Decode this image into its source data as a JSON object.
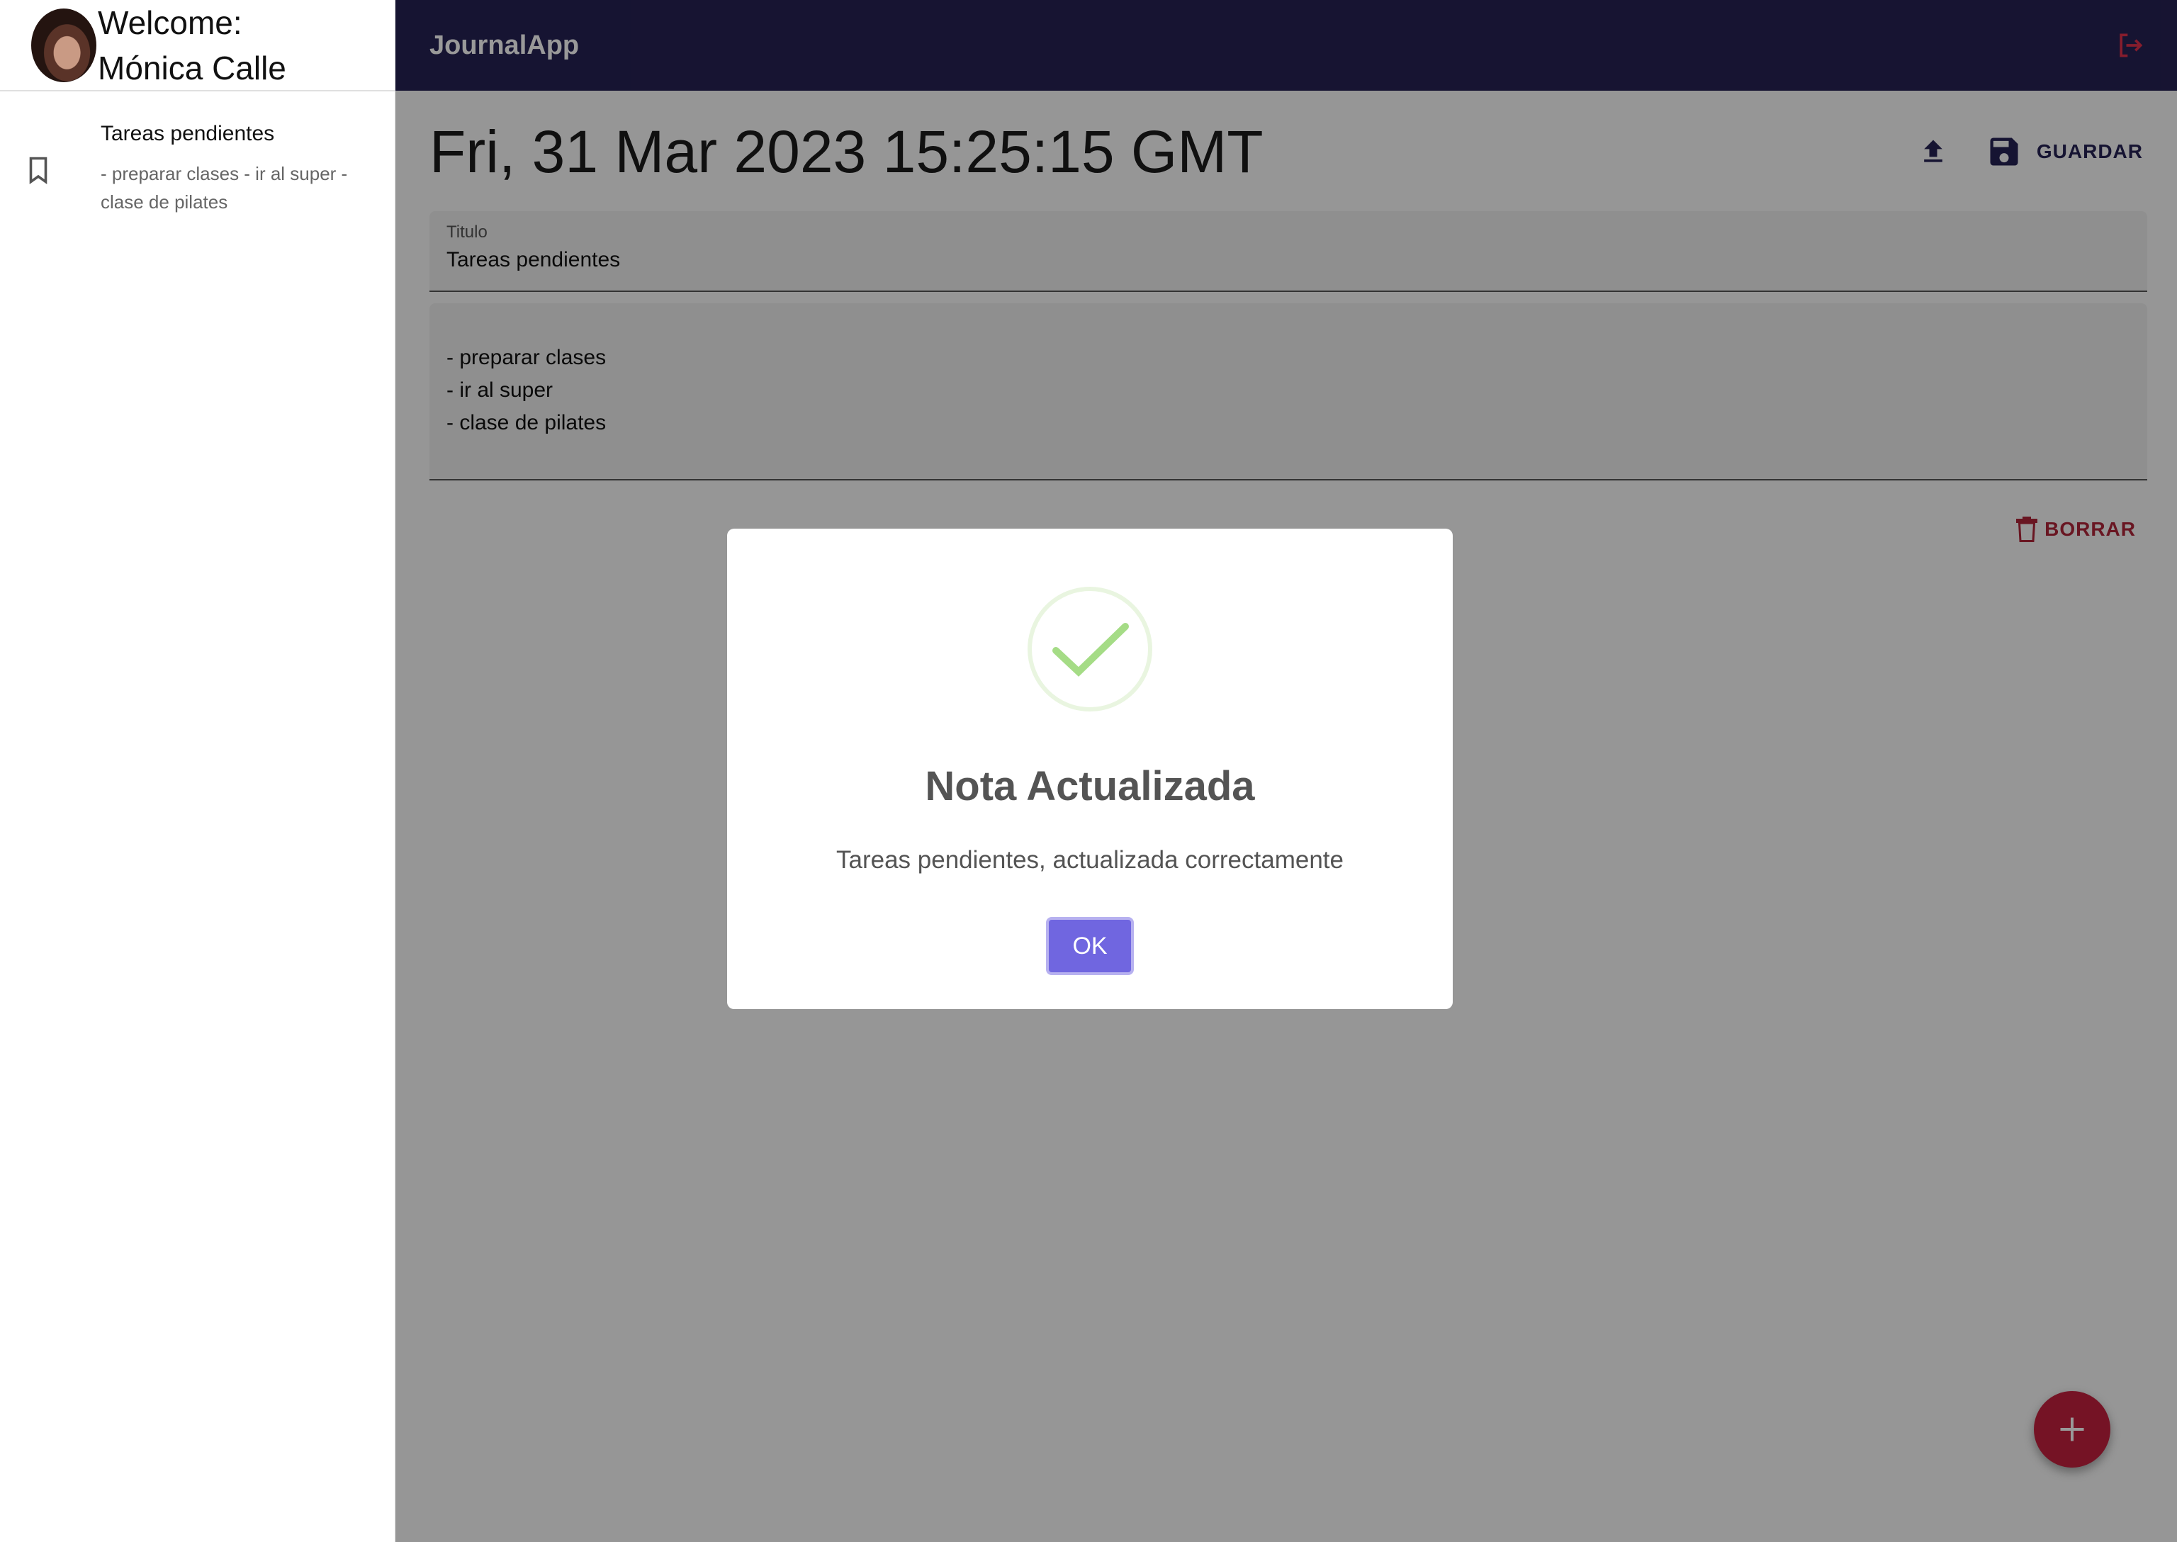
{
  "sidebar": {
    "welcome_label": "Welcome:",
    "user_name": "Mónica Calle",
    "notes": [
      {
        "title": "Tareas pendientes",
        "summary": "- preparar clases - ir al super - clase de pilates"
      }
    ]
  },
  "topbar": {
    "app_title": "JournalApp"
  },
  "note": {
    "date": "Fri, 31 Mar 2023 15:25:15 GMT",
    "save_label": "GUARDAR",
    "title_label": "Titulo",
    "title_value": "Tareas pendientes",
    "body_lines": [
      "- preparar clases",
      "- ir al super",
      "- clase de pilates"
    ],
    "delete_label": "BORRAR"
  },
  "dialog": {
    "title": "Nota Actualizada",
    "message": "Tareas pendientes, actualizada correctamente",
    "ok_label": "OK"
  },
  "icons": {
    "note_item": "bookmark-icon",
    "logout": "logout-icon",
    "upload": "upload-icon",
    "save": "save-icon",
    "delete": "trash-icon",
    "add": "plus-icon",
    "success": "check-circle-icon"
  },
  "colors": {
    "appbar": "#262254",
    "accent_red": "#c4213e",
    "dialog_button": "#7066e0",
    "success_green": "#a5dc86"
  }
}
